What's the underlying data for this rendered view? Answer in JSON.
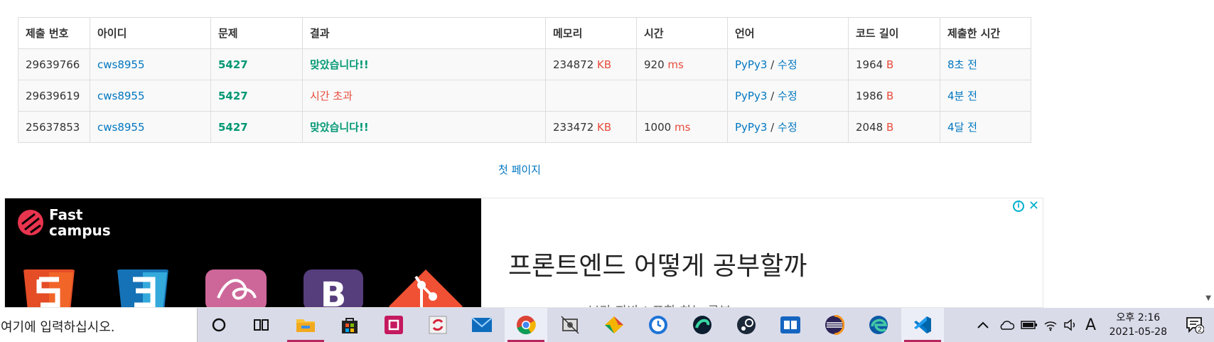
{
  "table": {
    "headers": [
      "제출 번호",
      "아이디",
      "문제",
      "결과",
      "메모리",
      "시간",
      "언어",
      "코드 길이",
      "제출한 시간"
    ],
    "rows": [
      {
        "id": "29639766",
        "user": "cws8955",
        "problem": "5427",
        "result": "맞았습니다!!",
        "result_type": "accepted",
        "memory": "234872",
        "memory_unit": "KB",
        "time": "920",
        "time_unit": "ms",
        "lang": "PyPy3",
        "sep": "/",
        "edit": "수정",
        "length": "1964",
        "length_unit": "B",
        "submitted": "8초 전"
      },
      {
        "id": "29639619",
        "user": "cws8955",
        "problem": "5427",
        "result": "시간 초과",
        "result_type": "tle",
        "memory": "",
        "memory_unit": "",
        "time": "",
        "time_unit": "",
        "lang": "PyPy3",
        "sep": "/",
        "edit": "수정",
        "length": "1986",
        "length_unit": "B",
        "submitted": "4분 전"
      },
      {
        "id": "25637853",
        "user": "cws8955",
        "problem": "5427",
        "result": "맞았습니다!!",
        "result_type": "accepted",
        "memory": "233472",
        "memory_unit": "KB",
        "time": "1000",
        "time_unit": "ms",
        "lang": "PyPy3",
        "sep": "/",
        "edit": "수정",
        "length": "2048",
        "length_unit": "B",
        "submitted": "4달 전"
      }
    ]
  },
  "pagination": {
    "first_page": "첫 페이지"
  },
  "ad": {
    "brand_line1": "Fast",
    "brand_line2": "campus",
    "headline": "프론트엔드 어떻게 공부할까",
    "subline": "브라 자바 ! 포함 하는 공부",
    "info_glyph": "i",
    "close_glyph": "✕"
  },
  "taskbar": {
    "search_placeholder": "여기에 입력하십시오.",
    "ime_label": "A",
    "clock_ampm_time": "오후 2:16",
    "clock_date": "2021-05-28",
    "notification_count": "2",
    "icons": [
      "cortana-icon",
      "task-view-icon",
      "file-explorer-icon",
      "store-icon",
      "app-icon",
      "sync-app-icon",
      "mail-icon",
      "chrome-icon",
      "snipping-icon",
      "drive-icon",
      "clock-app-icon",
      "green-app-icon",
      "steam-icon",
      "reader-icon",
      "eclipse-icon",
      "edge-icon",
      "vscode-icon"
    ]
  },
  "colors": {
    "link": "#0076c0",
    "accepted": "#009874",
    "error": "#e74c3c",
    "taskbar": "#d9dbe9",
    "active_underline": "#b5285d"
  }
}
